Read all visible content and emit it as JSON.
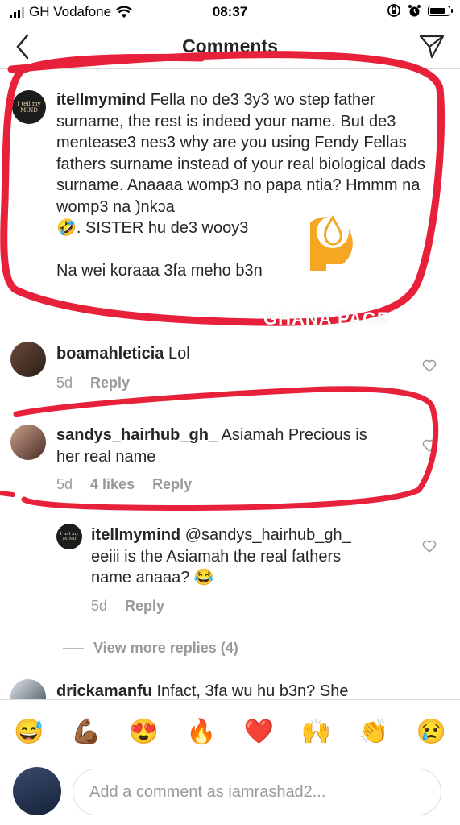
{
  "status_bar": {
    "carrier": "GH Vodafone",
    "time": "08:37"
  },
  "header": {
    "title": "Comments"
  },
  "comments": [
    {
      "username": "itellmymind",
      "text": "Fella no de3 3y3 wo step father surname, the rest is indeed your name. But de3 mentease3 nes3 why are you using Fendy Fellas fathers surname instead of your real biological dads surname. Anaaaa womp3 no papa ntia? Hmmm na womp3 na )nkɔa",
      "text_line2": ". SISTER hu de3 wooy3",
      "text_line3": "Na wei koraaa 3fa meho b3n",
      "emoji": "🤣",
      "avatar_text": "I tell my MIND"
    },
    {
      "username": "boamahleticia",
      "text": "Lol",
      "time": "5d",
      "reply_label": "Reply"
    },
    {
      "username": "sandys_hairhub_gh_",
      "text": "Asiamah Precious is",
      "text_line2": "her real name",
      "time": "5d",
      "likes": "4 likes",
      "reply_label": "Reply"
    },
    {
      "username": "itellmymind",
      "mention": "@sandys_hairhub_gh_",
      "text_line2": "eeiii is the Asiamah the real fathers",
      "text_line3": "name anaaa?",
      "emoji": "😂",
      "time": "5d",
      "reply_label": "Reply",
      "avatar_text": "I tell my MIND"
    },
    {
      "username": "drickamanfu",
      "text": "Infact, 3fa wu hu b3n? She"
    }
  ],
  "view_more_replies": "View more replies (4)",
  "emoji_bar": [
    "😅",
    "💪🏾",
    "😍",
    "🔥",
    "❤️",
    "🙌",
    "👏",
    "😢"
  ],
  "input": {
    "placeholder": "Add a comment as iamrashad2..."
  },
  "watermark": {
    "text": "GHANA PAGE"
  },
  "colors": {
    "annotation_red": "#e8213b",
    "watermark_orange": "#f5a623",
    "username_text": "#262626",
    "meta_gray": "#999999"
  }
}
